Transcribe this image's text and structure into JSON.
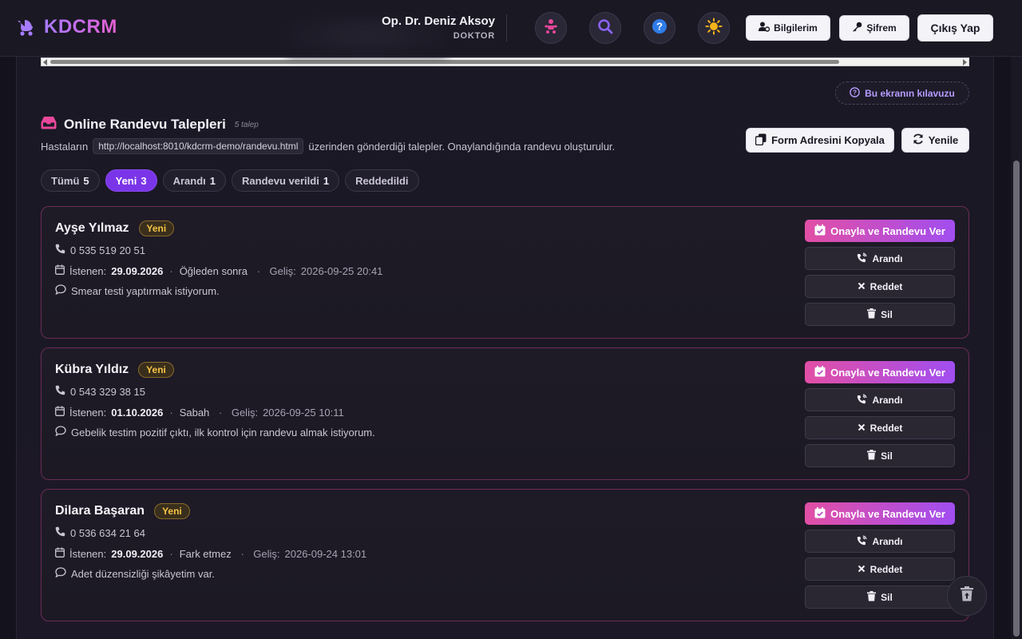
{
  "header": {
    "brand": "KDCRM",
    "user_name": "Op. Dr. Deniz Aksoy",
    "user_role": "DOKTOR",
    "buttons": {
      "profile": "Bilgilerim",
      "password": "Şifrem",
      "logout": "Çıkış Yap"
    },
    "icons": [
      "baby-icon",
      "search-icon",
      "help-icon",
      "sun-icon"
    ]
  },
  "guide_button": "Bu ekranın kılavuzu",
  "section": {
    "title": "Online Randevu Talepleri",
    "count": "5 talep",
    "subtitle_before": "Hastaların",
    "url": "http://localhost:8010/kdcrm-demo/randevu.html",
    "subtitle_after": "üzerinden gönderdiği talepler. Onaylandığında randevu oluşturulur.",
    "copy_button": "Form Adresini Kopyala",
    "refresh_button": "Yenile"
  },
  "filters": [
    {
      "label": "Tümü",
      "count": "5"
    },
    {
      "label": "Yeni",
      "count": "3"
    },
    {
      "label": "Arandı",
      "count": "1"
    },
    {
      "label": "Randevu verildi",
      "count": "1"
    },
    {
      "label": "Reddedildi",
      "count": ""
    }
  ],
  "card_labels": {
    "requested": "İstenen:",
    "arrival": "Geliş:",
    "approve": "Onayla ve Randevu Ver",
    "called": "Arandı",
    "reject": "Reddet",
    "delete": "Sil"
  },
  "requests": [
    {
      "name": "Ayşe Yılmaz",
      "status": "Yeni",
      "phone": "0 535 519 20 51",
      "date": "29.09.2026",
      "time_pref": "Öğleden sonra",
      "arrival": "2026-09-25 20:41",
      "note": "Smear testi yaptırmak istiyorum."
    },
    {
      "name": "Kübra Yıldız",
      "status": "Yeni",
      "phone": "0 543 329 38 15",
      "date": "01.10.2026",
      "time_pref": "Sabah",
      "arrival": "2026-09-25 10:11",
      "note": "Gebelik testim pozitif çıktı, ilk kontrol için randevu almak istiyorum."
    },
    {
      "name": "Dilara Başaran",
      "status": "Yeni",
      "phone": "0 536 634 21 64",
      "date": "29.09.2026",
      "time_pref": "Fark etmez",
      "arrival": "2026-09-24 13:01",
      "note": "Adet düzensizliği şikâyetim var."
    }
  ],
  "colors": {
    "accent": "#7a35e8",
    "brand_gradient_start": "#a67bff",
    "brand_gradient_end": "#e55fd0",
    "badge_new": "#f5c445",
    "card_border": "#6b2c55"
  }
}
